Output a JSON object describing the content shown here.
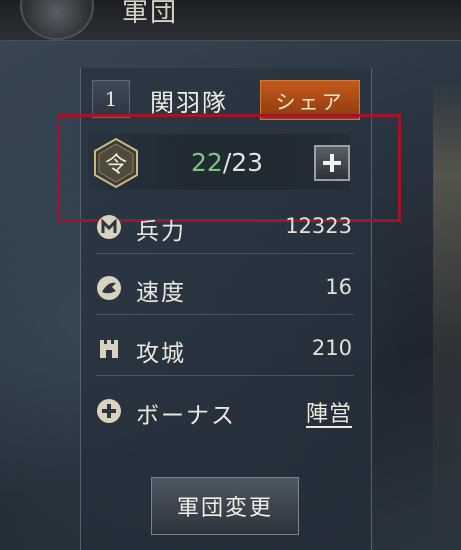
{
  "header": {
    "title": "軍団"
  },
  "troop": {
    "number": "1",
    "name": "関羽隊",
    "share_label": "シェア"
  },
  "order": {
    "current": "22",
    "separator": "/",
    "max": "23",
    "icon": "order-ling-icon",
    "icon_glyph": "令"
  },
  "stats": [
    {
      "icon": "troops-icon",
      "label": "兵力",
      "value": "12323"
    },
    {
      "icon": "speed-icon",
      "label": "速度",
      "value": "16"
    },
    {
      "icon": "siege-icon",
      "label": "攻城",
      "value": "210"
    },
    {
      "icon": "bonus-plus-icon",
      "label": "ボーナス",
      "link": "陣営"
    }
  ],
  "change_button": {
    "label": "軍団変更"
  },
  "colors": {
    "share": "#c35a1c",
    "highlight": "#a21427",
    "order_current": "#7cc47c"
  }
}
